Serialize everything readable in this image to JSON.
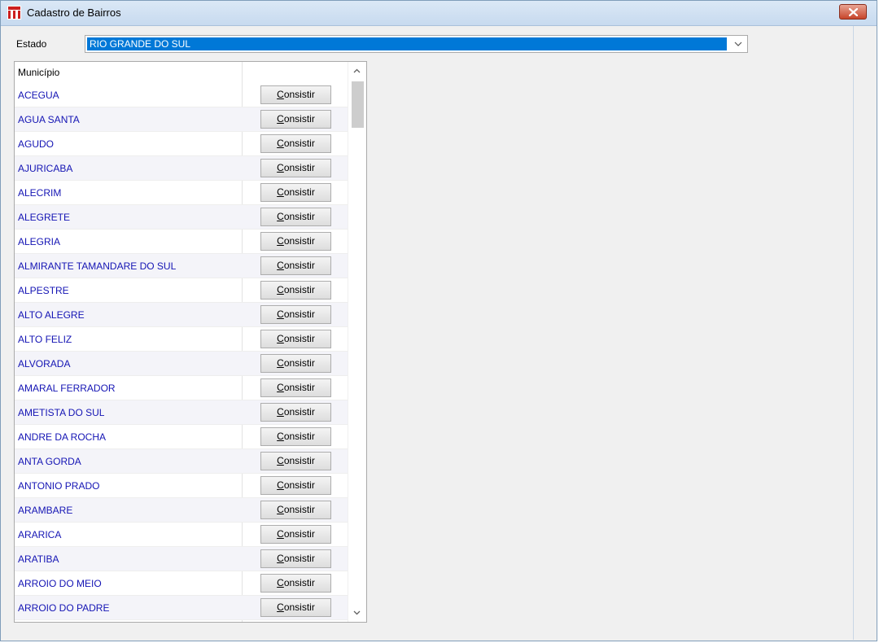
{
  "window": {
    "title": "Cadastro de Bairros",
    "icon": "app-logo-icon",
    "accent": "#cc1f1f"
  },
  "form": {
    "estado_label": "Estado",
    "estado_value": "RIO GRANDE DO SUL"
  },
  "grid": {
    "header_municipio": "Município",
    "button_label_underlined": "C",
    "button_label_rest": "onsistir",
    "rows": [
      "ACEGUA",
      "AGUA SANTA",
      "AGUDO",
      "AJURICABA",
      "ALECRIM",
      "ALEGRETE",
      "ALEGRIA",
      "ALMIRANTE TAMANDARE DO SUL",
      "ALPESTRE",
      "ALTO ALEGRE",
      "ALTO FELIZ",
      "ALVORADA",
      "AMARAL FERRADOR",
      "AMETISTA DO SUL",
      "ANDRE DA ROCHA",
      "ANTA GORDA",
      "ANTONIO PRADO",
      "ARAMBARE",
      "ARARICA",
      "ARATIBA",
      "ARROIO DO MEIO",
      "ARROIO DO PADRE"
    ]
  },
  "colors": {
    "selection": "#0078d7",
    "row_text": "#1414b4",
    "close_button": "#c7452b"
  }
}
